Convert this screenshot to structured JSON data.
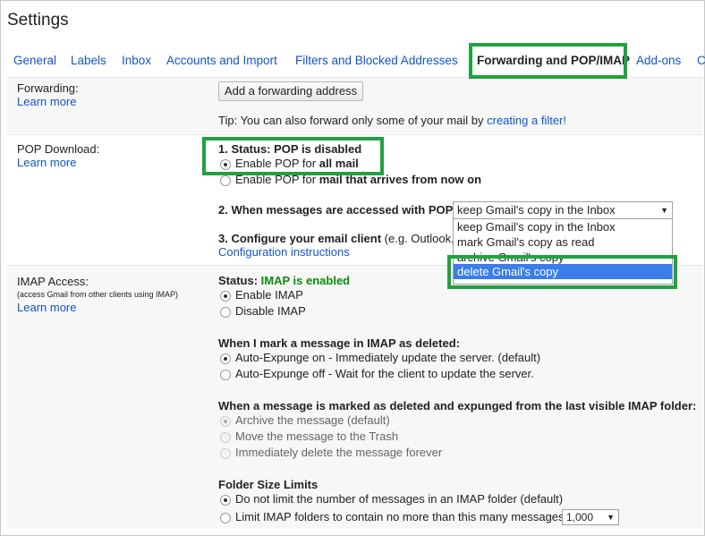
{
  "window": {
    "title": "Settings"
  },
  "tabs": [
    {
      "label": "General",
      "active": false
    },
    {
      "label": "Labels",
      "active": false
    },
    {
      "label": "Inbox",
      "active": false
    },
    {
      "label": "Accounts and Import",
      "active": false
    },
    {
      "label": "Filters and Blocked Addresses",
      "active": false
    },
    {
      "label": "Forwarding and POP/IMAP",
      "active": true
    },
    {
      "label": "Add-ons",
      "active": false
    },
    {
      "label": "C",
      "active": false
    }
  ],
  "forwarding": {
    "label": "Forwarding:",
    "learn_more": "Learn more",
    "add_button": "Add a forwarding address",
    "tip_prefix": "Tip: You can also forward only some of your mail by ",
    "tip_link": "creating a filter!"
  },
  "pop": {
    "label": "POP Download:",
    "learn_more": "Learn more",
    "status_prefix": "1. Status: ",
    "status_value": "POP is disabled",
    "enable_all_prefix": "Enable POP for ",
    "enable_all_bold": "all mail",
    "enable_new_prefix": "Enable POP for ",
    "enable_new_bold": "mail that arrives from now on",
    "when_accessed": "2. When messages are accessed with POP",
    "selected": "keep Gmail's copy in the Inbox",
    "options": [
      "keep Gmail's copy in the Inbox",
      "mark Gmail's copy as read",
      "archive Gmail's copy",
      "delete Gmail's copy"
    ],
    "configure_bold": "3. Configure your email client",
    "configure_rest": " (e.g. Outlook,",
    "config_link": "Configuration instructions"
  },
  "imap": {
    "label": "IMAP Access:",
    "sublabel": "(access Gmail from other clients using IMAP)",
    "learn_more": "Learn more",
    "status_prefix": "Status: ",
    "status_value": "IMAP is enabled",
    "enable": "Enable IMAP",
    "disable": "Disable IMAP",
    "deleted_heading": "When I mark a message in IMAP as deleted:",
    "expunge_on": "Auto-Expunge on - Immediately update the server. (default)",
    "expunge_off": "Auto-Expunge off - Wait for the client to update the server.",
    "expunged_heading": "When a message is marked as deleted and expunged from the last visible IMAP folder:",
    "archive": "Archive the message (default)",
    "trash": "Move the message to the Trash",
    "delete_forever": "Immediately delete the message forever",
    "folder_heading": "Folder Size Limits",
    "no_limit": "Do not limit the number of messages in an IMAP folder (default)",
    "limit": "Limit IMAP folders to contain no more than this many messages",
    "limit_value": "1,000"
  },
  "colors": {
    "link": "#1155cc",
    "highlight": "#21a141",
    "enabled": "#0a8a0a",
    "selected": "#3b7de9"
  }
}
